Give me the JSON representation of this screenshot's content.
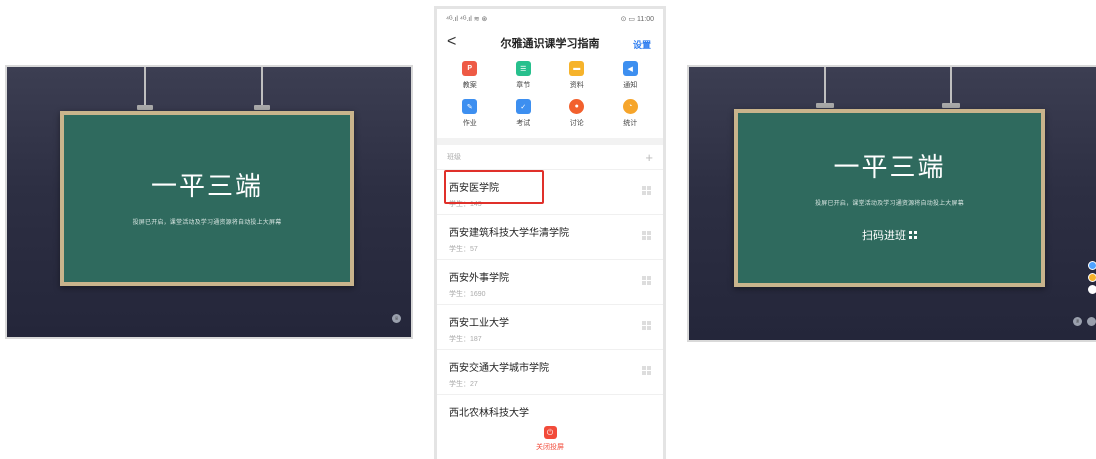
{
  "left_screen": {
    "title": "一平三端",
    "subtitle": "投屏已开启，课堂活动及学习通资源将自动投上大屏幕",
    "button_label": "设"
  },
  "phone": {
    "status_left": "⁴ᴳ.ıl ⁴ᴳ.ıl ≋ ⊛",
    "status_right": "⊙ ▭ 11:00",
    "back_label": "<",
    "title": "尔雅通识课学习指南",
    "settings_label": "设置",
    "features": [
      {
        "label": "教案",
        "glyph": "P",
        "color": "#ee5a45"
      },
      {
        "label": "章节",
        "glyph": "☰",
        "color": "#27c08d"
      },
      {
        "label": "资料",
        "glyph": "▬",
        "color": "#f6b32b"
      },
      {
        "label": "通知",
        "glyph": "◀",
        "color": "#3d8ff0"
      },
      {
        "label": "作业",
        "glyph": "✎",
        "color": "#3d8ff0"
      },
      {
        "label": "考试",
        "glyph": "✓",
        "color": "#3d8ff0"
      },
      {
        "label": "讨论",
        "glyph": "●",
        "color": "#f2602d"
      },
      {
        "label": "统计",
        "glyph": "◔",
        "color": "#f6a52b"
      }
    ],
    "section_label": "班级",
    "section_add": "+",
    "classes": [
      {
        "name": "西安医学院",
        "count": "学生：143"
      },
      {
        "name": "西安建筑科技大学华清学院",
        "count": "学生：57"
      },
      {
        "name": "西安外事学院",
        "count": "学生：1690"
      },
      {
        "name": "西安工业大学",
        "count": "学生：187"
      },
      {
        "name": "西安交通大学城市学院",
        "count": "学生：27"
      },
      {
        "name": "西北农林科技大学",
        "count": ""
      }
    ],
    "bottom_icon": "⏻",
    "bottom_label": "关闭投屏"
  },
  "right_screen": {
    "title": "一平三端",
    "subtitle": "投屏已开启，课堂活动及学习通资源将自动投上大屏幕",
    "join_label": "扫码进班",
    "button_label": "退"
  }
}
